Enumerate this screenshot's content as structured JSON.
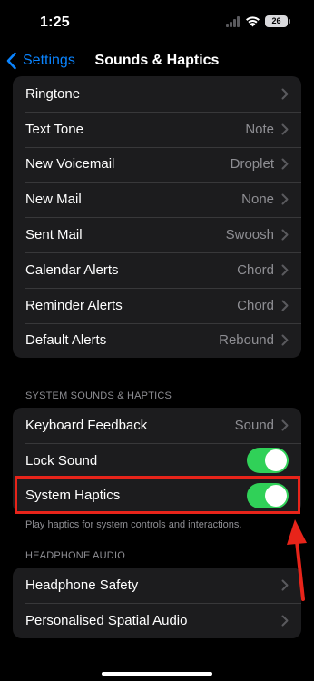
{
  "status_bar": {
    "time": "1:25",
    "battery": "26"
  },
  "nav": {
    "back_label": "Settings",
    "title": "Sounds & Haptics"
  },
  "alerts_group": {
    "items": [
      {
        "label": "Ringtone",
        "value": ""
      },
      {
        "label": "Text Tone",
        "value": "Note"
      },
      {
        "label": "New Voicemail",
        "value": "Droplet"
      },
      {
        "label": "New Mail",
        "value": "None"
      },
      {
        "label": "Sent Mail",
        "value": "Swoosh"
      },
      {
        "label": "Calendar Alerts",
        "value": "Chord"
      },
      {
        "label": "Reminder Alerts",
        "value": "Chord"
      },
      {
        "label": "Default Alerts",
        "value": "Rebound"
      }
    ]
  },
  "system_group": {
    "header": "SYSTEM SOUNDS & HAPTICS",
    "keyboard_feedback": {
      "label": "Keyboard Feedback",
      "value": "Sound"
    },
    "lock_sound": {
      "label": "Lock Sound",
      "on": true
    },
    "system_haptics": {
      "label": "System Haptics",
      "on": true
    },
    "footer": "Play haptics for system controls and interactions."
  },
  "headphone_group": {
    "header": "HEADPHONE AUDIO",
    "items": [
      {
        "label": "Headphone Safety"
      },
      {
        "label": "Personalised Spatial Audio"
      }
    ]
  },
  "colors": {
    "accent": "#0a84ff",
    "toggle_on": "#30d158",
    "annotation": "#e8241a",
    "background": "#000000",
    "group_bg": "#1c1c1e"
  }
}
